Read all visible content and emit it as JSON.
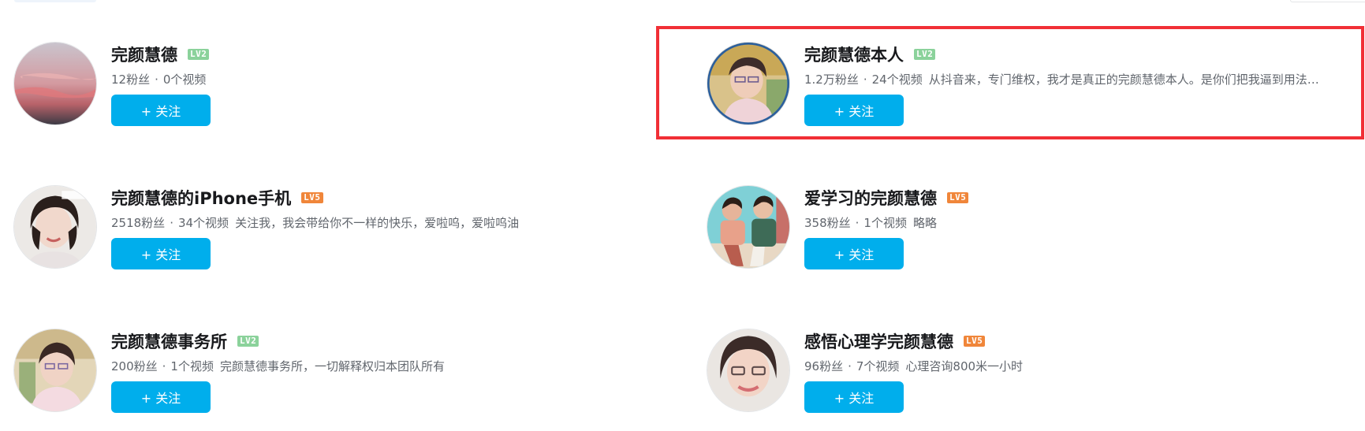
{
  "users": [
    {
      "name": "完颜慧德",
      "level": "LV2",
      "followers": "12粉丝",
      "videos": "0个视频",
      "signature": "",
      "follow_label": "+ 关注"
    },
    {
      "name": "完颜慧德本人",
      "level": "LV2",
      "followers": "1.2万粉丝",
      "videos": "24个视频",
      "signature": "从抖音来，专门维权，我才是真正的完颜慧德本人。是你们把我逼到用法…",
      "follow_label": "+ 关注"
    },
    {
      "name": "完颜慧德的iPhone手机",
      "level": "LV5",
      "followers": "2518粉丝",
      "videos": "34个视频",
      "signature": "关注我，我会带给你不一样的快乐，爱啦呜，爱啦呜油",
      "follow_label": "+ 关注"
    },
    {
      "name": "爱学习的完颜慧德",
      "level": "LV5",
      "followers": "358粉丝",
      "videos": "1个视频",
      "signature": "略略",
      "follow_label": "+ 关注"
    },
    {
      "name": "完颜慧德事务所",
      "level": "LV2",
      "followers": "200粉丝",
      "videos": "1个视频",
      "signature": "完颜慧德事务所，一切解释权归本团队所有",
      "follow_label": "+ 关注"
    },
    {
      "name": "感悟心理学完颜慧德",
      "level": "LV5",
      "followers": "96粉丝",
      "videos": "7个视频",
      "signature": "心理咨询800米一小时",
      "follow_label": "+ 关注"
    }
  ],
  "separator": "·",
  "colors": {
    "follow_button": "#00aeec",
    "level_low": "#8bd29b",
    "level_high": "#f0863a",
    "highlight_border": "#f12f36"
  }
}
